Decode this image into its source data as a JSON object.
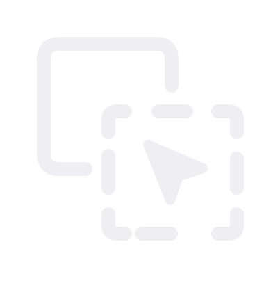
{
  "icon": {
    "name": "select-area-cursor-icon",
    "color": "#efeff3"
  }
}
